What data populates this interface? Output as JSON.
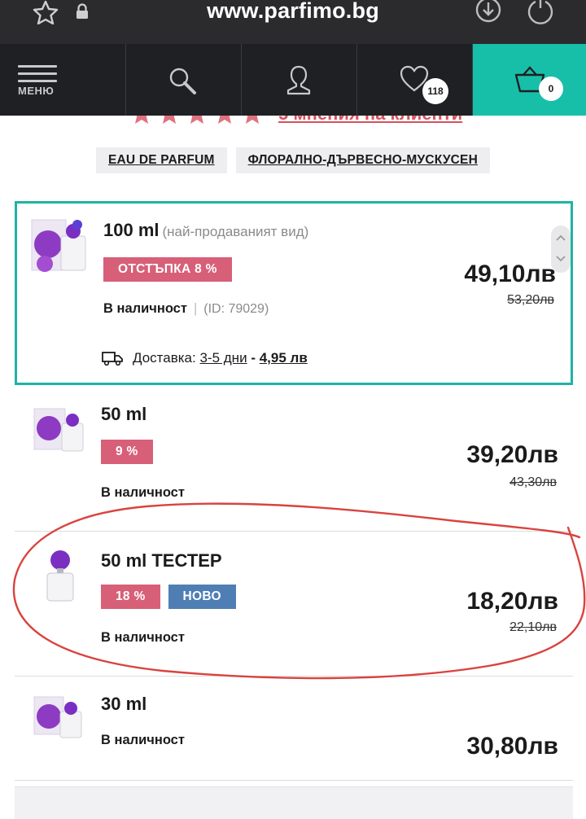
{
  "browser": {
    "url": "www.parfimo.bg"
  },
  "nav": {
    "menu_label": "МЕНЮ",
    "favorites_count": "118",
    "cart_count": "0"
  },
  "reviews": {
    "link_text": "5 мнения на клиенти",
    "rating_stars": 5
  },
  "tags": [
    "EAU DE PARFUM",
    "ФЛОРАЛНО-ДЪРВЕСНО-МУСКУСЕН"
  ],
  "variants": [
    {
      "title": "100 ml",
      "subtitle": "(най-продаваният вид)",
      "badges": [
        "ОТСТЪПКА 8 %"
      ],
      "stock": "В наличност",
      "id": "(ID: 79029)",
      "price": "49,10лв",
      "old_price": "53,20лв",
      "delivery": {
        "label": "Доставка:",
        "days": "3-5 дни",
        "dash": "-",
        "cost": "4,95 лв"
      },
      "selected": true
    },
    {
      "title": "50 ml",
      "badges": [
        "9 %"
      ],
      "stock": "В наличност",
      "price": "39,20лв",
      "old_price": "43,30лв"
    },
    {
      "title": "50 ml ТЕСТЕР",
      "badges": [
        "18 %",
        "НОВО"
      ],
      "stock": "В наличност",
      "price": "18,20лв",
      "old_price": "22,10лв"
    },
    {
      "title": "30 ml",
      "stock": "В наличност",
      "price": "30,80лв"
    }
  ],
  "icons": {
    "browser": [
      "star-icon",
      "lock-icon",
      "download-icon",
      "power-icon"
    ],
    "nav": [
      "menu-icon",
      "search-icon",
      "user-icon",
      "heart-icon",
      "cart-icon"
    ],
    "delivery": "truck-icon"
  },
  "colors": {
    "accent_teal": "#18bfa8",
    "discount_pink": "#d75f78",
    "new_blue": "#4f7eb4",
    "annotation_red": "#d9433f",
    "nav_dark": "#1e2023"
  }
}
